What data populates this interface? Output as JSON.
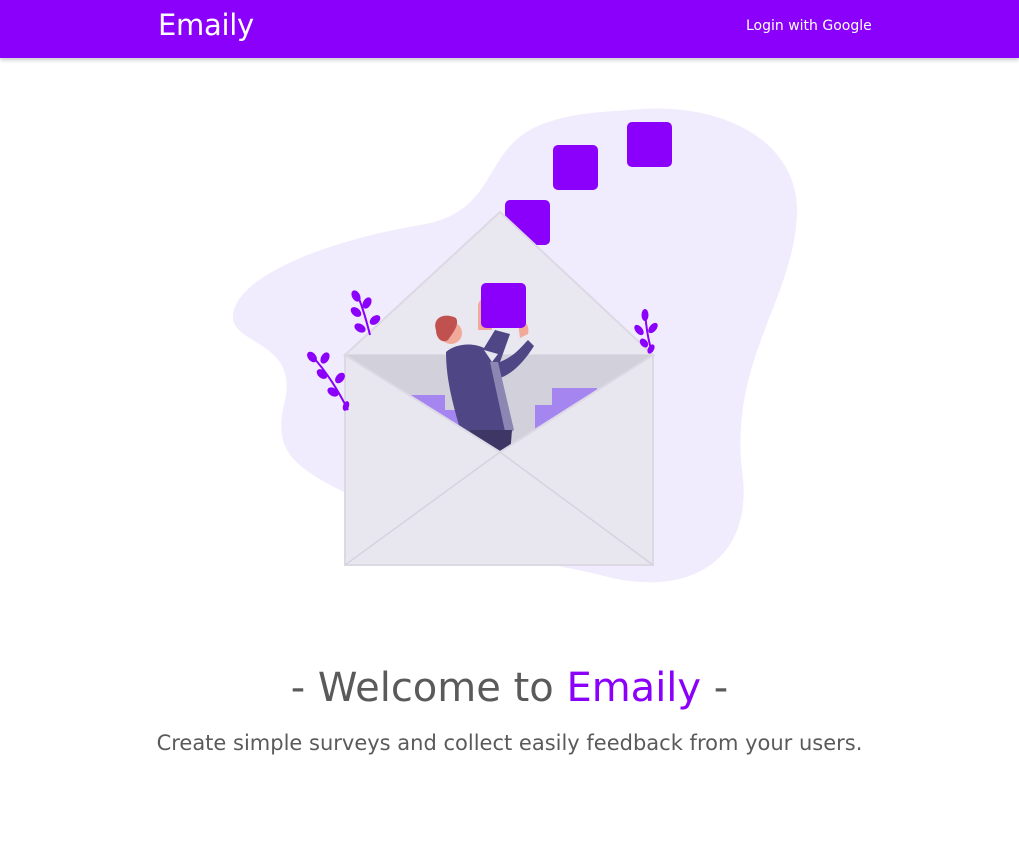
{
  "navbar": {
    "brand": "Emaily",
    "login_label": "Login with Google"
  },
  "hero": {
    "title_prefix": "- Welcome to ",
    "title_brand": "Emaily",
    "title_suffix": " -",
    "subtitle": "Create simple surveys and collect easily feedback from your users."
  },
  "colors": {
    "brand": "#8a00fb",
    "text": "#5a5a5a",
    "blob": "#f1ecfd",
    "envelope": "#e8e6ef"
  }
}
